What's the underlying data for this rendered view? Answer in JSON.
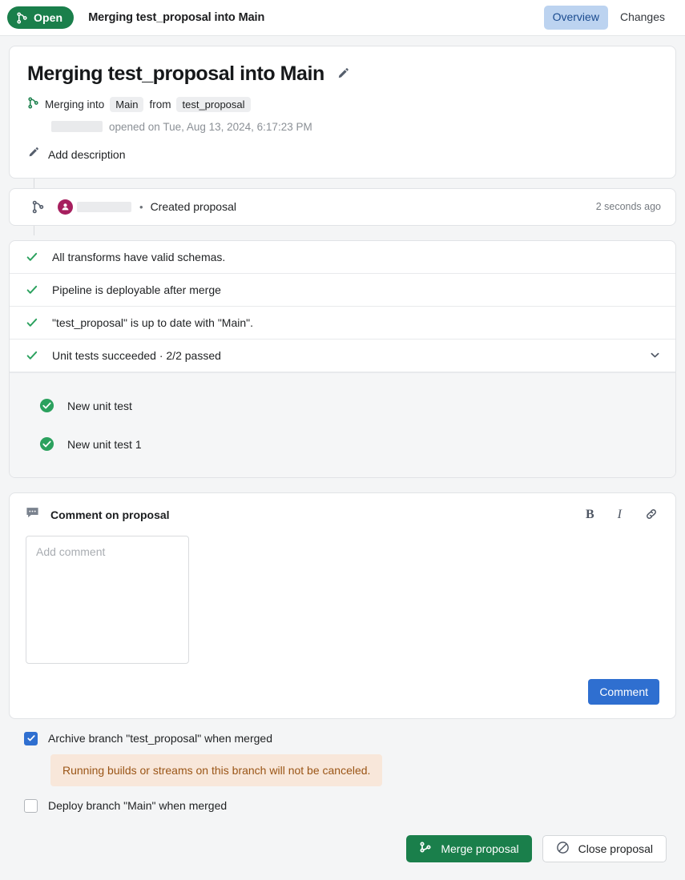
{
  "topbar": {
    "status_label": "Open",
    "status_icon": "git-merge-icon",
    "title": "Merging test_proposal into Main",
    "tabs": [
      {
        "label": "Overview",
        "active": true
      },
      {
        "label": "Changes",
        "active": false
      }
    ]
  },
  "header": {
    "title": "Merging test_proposal into Main",
    "edit_icon": "pencil-icon",
    "merge_icon": "git-merge-icon",
    "merging_prefix": "Merging into",
    "target_branch": "Main",
    "merging_from": "from",
    "source_branch": "test_proposal",
    "opened_text": "opened on Tue, Aug 13, 2024, 6:17:23 PM",
    "add_description_label": "Add description",
    "add_description_icon": "pencil-icon"
  },
  "activity": {
    "icon": "git-merge-icon",
    "avatar_icon": "user-avatar-icon",
    "separator": "•",
    "text": "Created proposal",
    "time": "2 seconds ago"
  },
  "checks": {
    "items": [
      {
        "icon": "check-icon",
        "label": "All transforms have valid schemas."
      },
      {
        "icon": "check-icon",
        "label": "Pipeline is deployable after merge"
      },
      {
        "icon": "check-icon",
        "label": "\"test_proposal\" is up to date with \"Main\"."
      }
    ],
    "unit_tests": {
      "icon": "check-icon",
      "label": "Unit tests succeeded · 2/2 passed",
      "chevron_icon": "chevron-down-icon",
      "expanded": true,
      "tests": [
        {
          "icon": "check-circle-icon",
          "label": "New unit test"
        },
        {
          "icon": "check-circle-icon",
          "label": "New unit test 1"
        }
      ]
    }
  },
  "comment": {
    "icon": "comment-bubble-icon",
    "title": "Comment on proposal",
    "tools": [
      {
        "name": "bold-button",
        "label": "B"
      },
      {
        "name": "italic-button",
        "label": "I"
      },
      {
        "name": "link-button",
        "label": "link-icon"
      }
    ],
    "placeholder": "Add comment",
    "value": "",
    "submit_label": "Comment"
  },
  "options": [
    {
      "label": "Archive branch \"test_proposal\" when merged",
      "checked": true,
      "warning": "Running builds or streams on this branch will not be canceled."
    },
    {
      "label": "Deploy branch \"Main\" when merged",
      "checked": false,
      "warning": ""
    }
  ],
  "footer": {
    "merge_label": "Merge proposal",
    "merge_icon": "git-merge-icon",
    "close_label": "Close proposal",
    "close_icon": "circle-slash-icon"
  },
  "colors": {
    "status_green": "#1a7f4b",
    "accent_blue": "#2f6fd0",
    "tab_active_bg": "#bcd3f0",
    "check_green": "#2ba15e",
    "warning_bg": "#f8e7da",
    "warning_text": "#9a5516",
    "avatar": "#a61f5e"
  }
}
